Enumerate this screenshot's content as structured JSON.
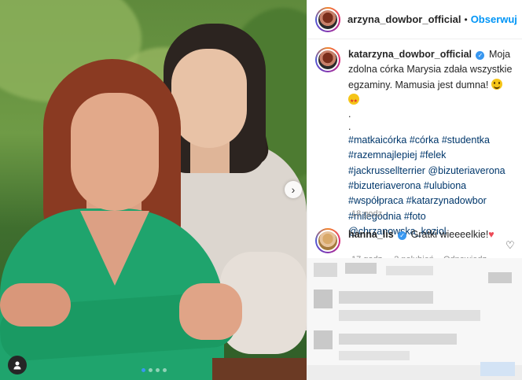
{
  "post": {
    "username_header": "arzyna_dowbor_official",
    "separator": "•",
    "follow_label": "Obserwuj",
    "caption": {
      "username": "katarzyna_dowbor_official",
      "text": "Moja zdolna córka Marysia zdała wszystkie egzaminy. Mamusia jest dumna!",
      "dots": [
        ".",
        "."
      ],
      "hashtags_line1": [
        "#matkaicórka",
        "#córka",
        "#studentka"
      ],
      "hashtags_line2": [
        "#razemnajlepiej",
        "#felek"
      ],
      "hashtags_line3": [
        "#jackrussellterrier",
        "@bizuteriaverona"
      ],
      "hashtags_line4": [
        "#bizuteriaverona",
        "#ulubiona"
      ],
      "hashtags_line5": [
        "#współpraca",
        "#katarzynadowbor"
      ],
      "hashtags_line6": [
        "#milegodnia",
        "#foto"
      ],
      "hashtags_line7": [
        "@chrzanowska_koziol"
      ]
    },
    "timestamp": "18 godz.",
    "comment": {
      "username": "hanna_lis",
      "text": "Gratki wieeeelkie!",
      "meta_time": "17 godz.",
      "meta_likes": "2 polubień",
      "meta_reply": "Odpowiedz"
    }
  },
  "colors": {
    "follow": "#0095f6",
    "hashtag": "#00376b",
    "verified": "#3897f0",
    "heart": "#ed4956"
  },
  "icons": {
    "verified": "verified-badge-icon",
    "heart": "heart-icon",
    "next": "chevron-right-icon",
    "tag": "user-tag-icon"
  }
}
